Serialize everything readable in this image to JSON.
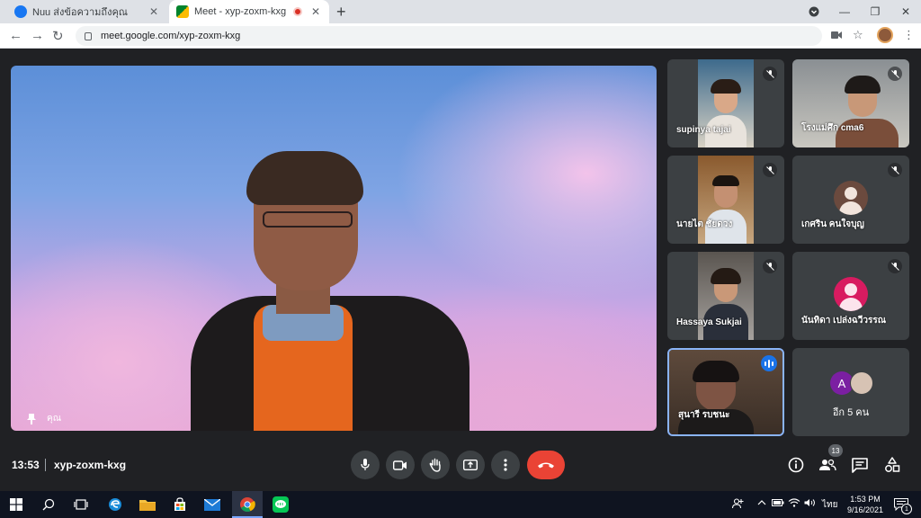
{
  "browser": {
    "tabs": [
      {
        "title": "Nuu ส่งข้อความถึงคุณ"
      },
      {
        "title": "Meet - xyp-zoxm-kxg"
      }
    ],
    "url": "meet.google.com/xyp-zoxm-kxg"
  },
  "meet": {
    "main_speaker": {
      "name": "คุณ"
    },
    "tiles": [
      {
        "name": "supinya tajai"
      },
      {
        "name": "โรงแม่ศึก cma6"
      },
      {
        "name": "นายไต ชัยดวง"
      },
      {
        "name": "เกศริน คนใจบุญ"
      },
      {
        "name": "Hassaya Sukjai"
      },
      {
        "name": "นันทิดา เปล่งฉวีวรรณ"
      },
      {
        "name": "สุนารี รบชนะ"
      }
    ],
    "more": {
      "avatar_letter": "A",
      "label": "อีก 5 คน"
    },
    "time": "13:53",
    "meeting_code": "xyp-zoxm-kxg",
    "participants_count": "13"
  },
  "taskbar": {
    "time": "1:53 PM",
    "date": "9/16/2021",
    "lang": "ไทย",
    "notif_count": "1"
  }
}
